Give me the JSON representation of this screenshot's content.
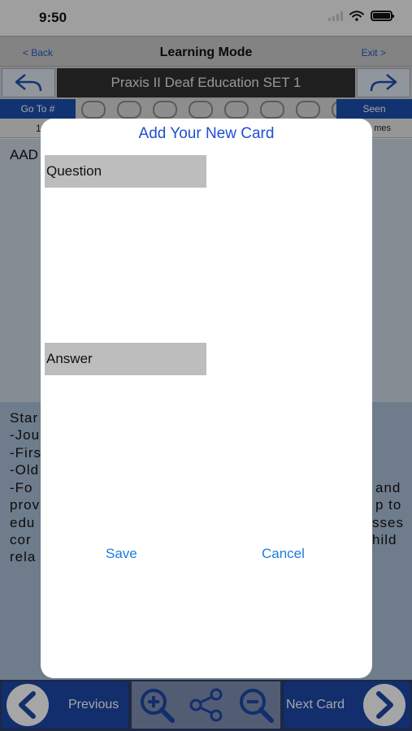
{
  "status": {
    "time": "9:50"
  },
  "nav": {
    "back": "< Back",
    "title": "Learning Mode",
    "exit": "Exit >"
  },
  "set": {
    "title": "Praxis II Deaf Education SET 1"
  },
  "toolbar": {
    "goto": "Go To #",
    "seen": "Seen"
  },
  "counter": {
    "left": "1",
    "right": "mes"
  },
  "card": {
    "question_partial": "AAD",
    "answer_lines": [
      "Star",
      "-Jou",
      "-Firs",
      "-Old",
      "-Fo",
      "and",
      "prov",
      "p to",
      "edu",
      "sses",
      "cor",
      "hild",
      "rela"
    ]
  },
  "modal": {
    "title": "Add Your New Card",
    "question_label": "Question",
    "answer_label": "Answer",
    "question_value": "",
    "answer_value": "",
    "save": "Save",
    "cancel": "Cancel"
  },
  "bottom": {
    "previous": "Previous",
    "next": "Next Card"
  },
  "icons": [
    "wifi-icon",
    "battery-icon",
    "back-arrow-icon",
    "forward-arrow-icon",
    "chevron-left-icon",
    "chevron-right-icon",
    "zoom-in-icon",
    "share-icon",
    "zoom-out-icon"
  ],
  "colors": {
    "accent_blue": "#1f4fd1",
    "button_blue": "#1d4fae",
    "link_blue": "#1f7be0",
    "answer_bg": "#a9bfd8"
  }
}
